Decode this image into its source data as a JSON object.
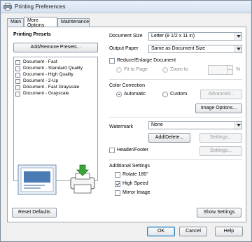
{
  "window": {
    "title": "Printing Preferences",
    "icon": "printer-icon"
  },
  "tabs": [
    {
      "label": "Main",
      "active": false
    },
    {
      "label": "More Options",
      "active": true
    },
    {
      "label": "Maintenance",
      "active": false
    }
  ],
  "presets": {
    "title": "Printing Presets",
    "add_button": "Add/Remove Presets...",
    "items": [
      "Document - Fast",
      "Document - Standard Quality",
      "Document - High Quality",
      "Document - 2-Up",
      "Document - Fast Grayscale",
      "Document - Grayscale"
    ]
  },
  "document_size": {
    "label": "Document Size",
    "value": "Letter (8 1/2 x 11 in)"
  },
  "output_paper": {
    "label": "Output Paper",
    "value": "Same as Document Size"
  },
  "reduce_enlarge": {
    "label": "Reduce/Enlarge Document",
    "checked": false,
    "fit_to_page": "Fit to Page",
    "zoom_to": "Zoom to",
    "zoom_unit": "%"
  },
  "color_correction": {
    "title": "Color Correction",
    "automatic": "Automatic",
    "custom": "Custom",
    "selected": "Automatic",
    "advanced_button": "Advanced...",
    "image_options_button": "Image Options..."
  },
  "watermark": {
    "label": "Watermark",
    "value": "None",
    "add_delete_button": "Add/Delete...",
    "settings_button": "Settings..."
  },
  "header_footer": {
    "label": "Header/Footer",
    "checked": false,
    "settings_button": "Settings..."
  },
  "additional_settings": {
    "title": "Additional Settings",
    "rotate": {
      "label": "Rotate 180°",
      "checked": false
    },
    "high_speed": {
      "label": "High Speed",
      "checked": true
    },
    "mirror_image": {
      "label": "Mirror Image",
      "checked": false
    }
  },
  "footer": {
    "reset_defaults": "Reset Defaults",
    "show_settings": "Show Settings",
    "ok": "OK",
    "cancel": "Cancel",
    "help": "Help"
  },
  "colors": {
    "title_bar": "#dbe6f3",
    "accent": "#3c7fb1",
    "printer_green": "#3aa63a"
  }
}
